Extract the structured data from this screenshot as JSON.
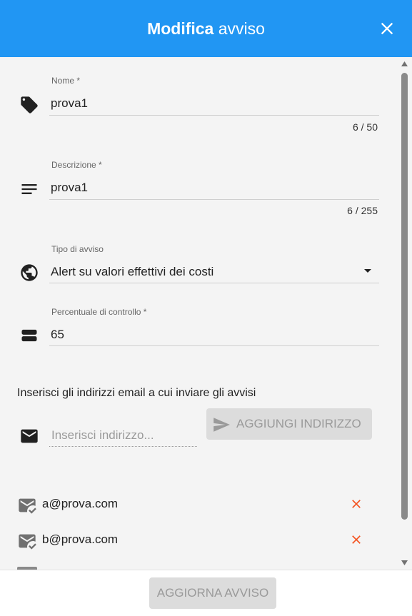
{
  "dialog": {
    "title_bold": "Modifica",
    "title_rest": "avviso"
  },
  "fields": {
    "name": {
      "label": "Nome *",
      "value": "prova1",
      "counter": "6 / 50"
    },
    "description": {
      "label": "Descrizione *",
      "value": "prova1",
      "counter": "6 / 255"
    },
    "alert_type": {
      "label": "Tipo di avviso",
      "value": "Alert su valori effettivi dei costi"
    },
    "percentage": {
      "label": "Percentuale di controllo *",
      "value": "65"
    }
  },
  "emails": {
    "section_title": "Inserisci gli indirizzi email a cui inviare gli avvisi",
    "input_placeholder": "Inserisci indirizzo...",
    "add_button": "AGGIUNGI INDIRIZZO",
    "list": [
      "a@prova.com",
      "b@prova.com"
    ]
  },
  "footer": {
    "update_button": "AGGIORNA AVVISO"
  },
  "icons": {
    "name": "tag-icon",
    "description": "notes-icon",
    "alert_type": "globe-icon",
    "percentage": "storage-icon",
    "email": "email-icon",
    "email_item": "mark-email-read-icon",
    "delete": "close-icon"
  },
  "colors": {
    "header": "#2196f3",
    "delete_icon": "#f4511e",
    "disabled_button": "#dcdcdc"
  }
}
